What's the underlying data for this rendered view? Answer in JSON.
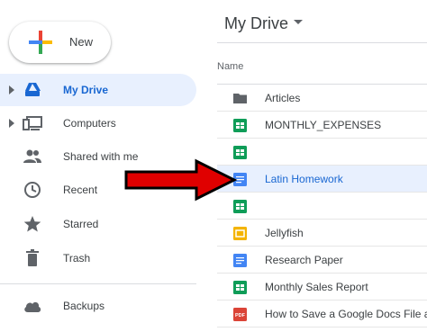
{
  "sidebar": {
    "new_label": "New",
    "items": [
      {
        "label": "My Drive",
        "icon": "my-drive-icon",
        "active": true,
        "expandable": true
      },
      {
        "label": "Computers",
        "icon": "computers-icon",
        "active": false,
        "expandable": true
      },
      {
        "label": "Shared with me",
        "icon": "people-icon",
        "active": false,
        "expandable": false
      },
      {
        "label": "Recent",
        "icon": "clock-icon",
        "active": false,
        "expandable": false
      },
      {
        "label": "Starred",
        "icon": "star-icon",
        "active": false,
        "expandable": false
      },
      {
        "label": "Trash",
        "icon": "trash-icon",
        "active": false,
        "expandable": false
      }
    ],
    "backups_label": "Backups"
  },
  "main": {
    "title": "My Drive",
    "column_header": "Name",
    "files": [
      {
        "name": "Articles",
        "type": "folder"
      },
      {
        "name": "MONTHLY_EXPENSES",
        "type": "sheets"
      },
      {
        "name": "",
        "type": "sheets"
      },
      {
        "name": "Latin Homework",
        "type": "docs",
        "selected": true
      },
      {
        "name": "",
        "type": "sheets"
      },
      {
        "name": "Jellyfish",
        "type": "slides"
      },
      {
        "name": "Research Paper",
        "type": "docs"
      },
      {
        "name": "Monthly Sales Report",
        "type": "sheets"
      },
      {
        "name": "How to Save a Google Docs File a",
        "type": "pdf"
      }
    ]
  },
  "colors": {
    "active_bg": "#e8f0fe",
    "active_text": "#1967d2",
    "sheets": "#0f9d58",
    "docs": "#4285f4",
    "slides": "#f4b400",
    "pdf": "#db4437",
    "folder": "#5f6368",
    "arrow_fill": "#e00000",
    "arrow_stroke": "#000000"
  }
}
